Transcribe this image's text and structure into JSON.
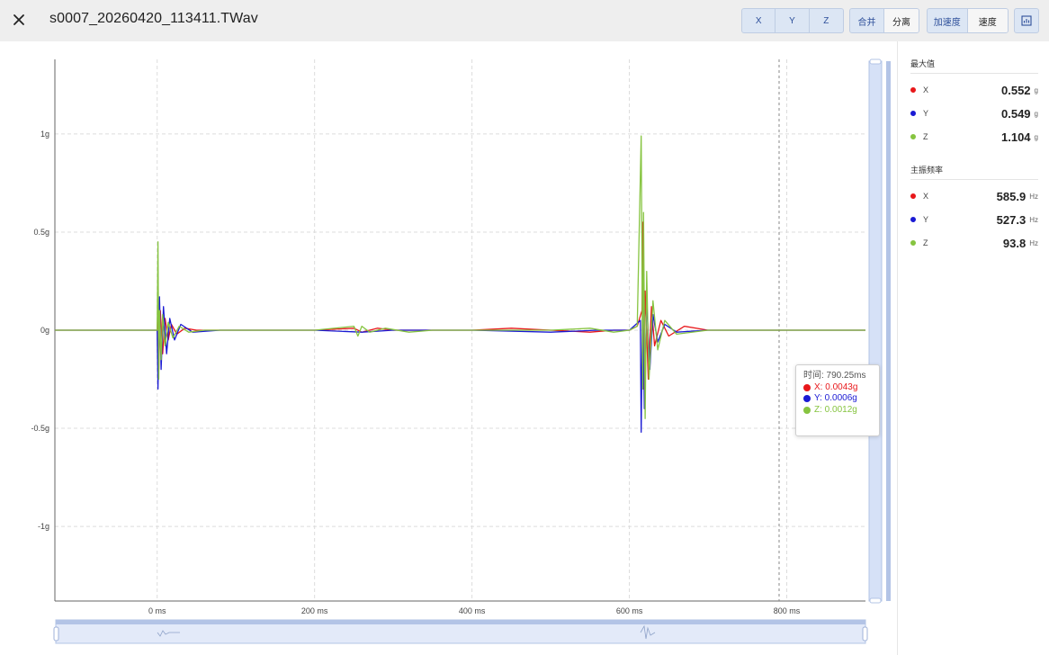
{
  "header": {
    "file_name": "s0007_20260420_113411.TWav",
    "axis_buttons": [
      "X",
      "Y",
      "Z"
    ],
    "mode_buttons": [
      "合并",
      "分离"
    ],
    "unit_buttons": [
      "加速度",
      "速度"
    ],
    "export_icon": "chart-export-icon"
  },
  "colors": {
    "x": "#e8171a",
    "y": "#1a1ad4",
    "z": "#86c440",
    "accent": "#2d4f9a"
  },
  "chart_data": {
    "type": "line",
    "x_unit": "ms",
    "y_unit": "g",
    "xlim": [
      -130,
      900
    ],
    "ylim": [
      -1.38,
      1.38
    ],
    "x_ticks": [
      0,
      200,
      400,
      600,
      800
    ],
    "x_tick_labels": [
      "0 ms",
      "200 ms",
      "400 ms",
      "600 ms",
      "800 ms"
    ],
    "y_ticks": [
      1,
      0.5,
      0,
      -0.5,
      -1
    ],
    "y_tick_labels": [
      "1g",
      "0.5g",
      "0g",
      "-0.5g",
      "-1g"
    ],
    "grid": true,
    "series": [
      {
        "name": "X",
        "x": [
          -130,
          -60,
          0,
          1,
          2,
          4,
          7,
          10,
          14,
          18,
          25,
          35,
          50,
          80,
          120,
          200,
          250,
          260,
          280,
          300,
          350,
          400,
          450,
          500,
          550,
          580,
          600,
          610,
          616,
          617,
          618,
          620,
          624,
          628,
          632,
          640,
          650,
          670,
          700,
          760,
          820,
          900
        ],
        "y": [
          0,
          0,
          0,
          0.12,
          -0.2,
          0.1,
          -0.12,
          0.06,
          -0.05,
          0.03,
          -0.02,
          0.01,
          0,
          0,
          0,
          0,
          0.01,
          -0.01,
          0.01,
          0,
          0,
          0,
          0.01,
          0,
          -0.01,
          0,
          0,
          0.02,
          0.1,
          0.55,
          -0.3,
          0.2,
          -0.25,
          0.12,
          -0.08,
          0.05,
          -0.03,
          0.02,
          0,
          0,
          0,
          0
        ]
      },
      {
        "name": "Y",
        "x": [
          -130,
          -60,
          0,
          1,
          3,
          5,
          8,
          12,
          16,
          22,
          30,
          45,
          80,
          200,
          260,
          300,
          400,
          500,
          560,
          600,
          614,
          615,
          617,
          619,
          622,
          626,
          630,
          636,
          645,
          660,
          700,
          900
        ],
        "y": [
          0,
          0,
          0,
          -0.3,
          0.17,
          -0.2,
          0.12,
          -0.12,
          0.06,
          -0.05,
          0.03,
          -0.01,
          0,
          0,
          -0.01,
          0,
          0,
          -0.01,
          0,
          0,
          0.05,
          -0.52,
          0.2,
          -0.4,
          0.15,
          -0.2,
          0.08,
          -0.06,
          0.03,
          -0.01,
          0,
          0
        ]
      },
      {
        "name": "Z",
        "x": [
          -130,
          -60,
          0,
          1,
          2,
          3,
          5,
          7,
          10,
          14,
          20,
          28,
          40,
          60,
          100,
          200,
          250,
          255,
          260,
          270,
          290,
          320,
          350,
          400,
          500,
          550,
          580,
          600,
          610,
          615,
          617,
          618,
          620,
          622,
          625,
          630,
          636,
          645,
          660,
          700,
          900
        ],
        "y": [
          0,
          0,
          0,
          0.45,
          -0.25,
          0.1,
          -0.15,
          0.08,
          -0.08,
          0.04,
          -0.04,
          0.02,
          -0.01,
          0,
          0,
          0,
          0.02,
          -0.03,
          0.02,
          -0.01,
          0.01,
          -0.01,
          0,
          0,
          0,
          0.01,
          -0.01,
          0,
          0.02,
          0.99,
          -0.3,
          0.6,
          -0.45,
          0.3,
          -0.25,
          0.15,
          -0.1,
          0.05,
          -0.02,
          0,
          0
        ]
      }
    ]
  },
  "tooltip": {
    "time": "时间: 790.25ms",
    "x": "X: 0.0043g",
    "y": "Y: 0.0006g",
    "z": "Z: 0.0012g"
  },
  "sidebar": {
    "max_title": "最大值",
    "max_items": [
      {
        "name": "X",
        "value": "0.552",
        "unit": "g"
      },
      {
        "name": "Y",
        "value": "0.549",
        "unit": "g"
      },
      {
        "name": "Z",
        "value": "1.104",
        "unit": "g"
      }
    ],
    "freq_title": "主振频率",
    "freq_items": [
      {
        "name": "X",
        "value": "585.9",
        "unit": "Hz"
      },
      {
        "name": "Y",
        "value": "527.3",
        "unit": "Hz"
      },
      {
        "name": "Z",
        "value": "93.8",
        "unit": "Hz"
      }
    ]
  }
}
